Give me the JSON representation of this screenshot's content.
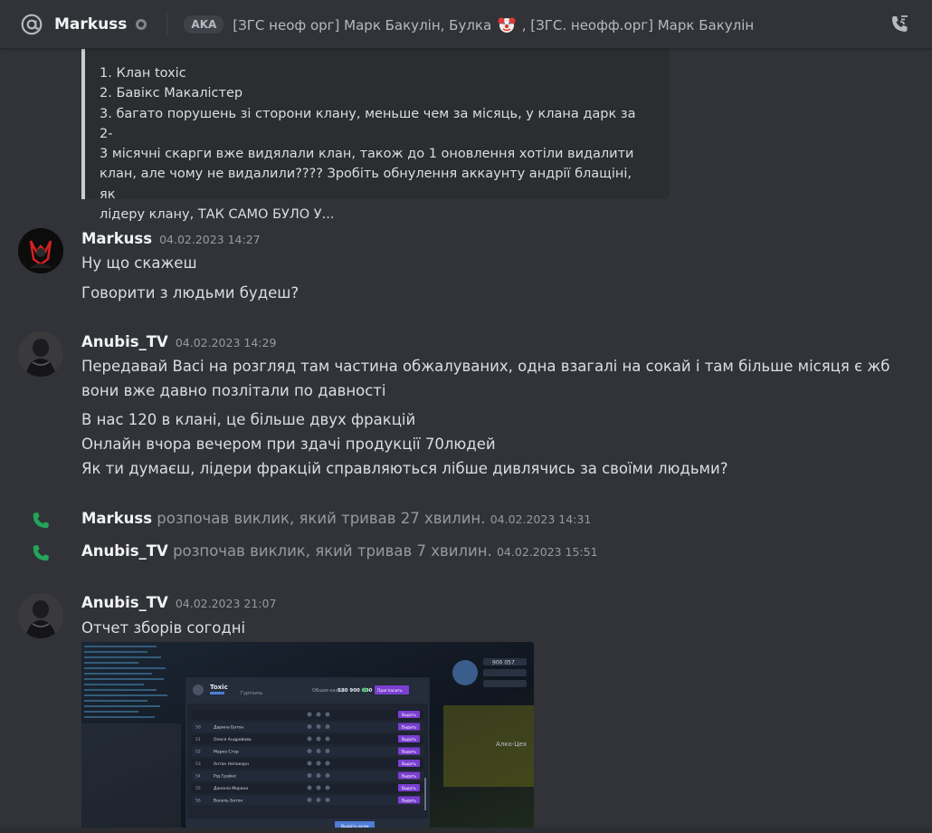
{
  "header": {
    "username": "Markuss",
    "aka_label": "AKA",
    "aka_names_part1": "[ЗГС неоф орг] Марк Бакулін, Булка",
    "aka_names_part2": ", [ЗГС. неофф.орг] Марк Бакулін",
    "icons": {
      "channel": "at-icon",
      "status": "offline-status-icon",
      "call": "start-call-icon",
      "emoji": "clown-emoji-icon"
    }
  },
  "quote": {
    "lines": [
      "1. Клан toxic",
      "2. Бавікс Макалістер",
      "3. багато порушень зі сторони клану, меньше чем за місяць, у клана дарк за 2-",
      "3 місячні скарги вже видялали клан, також до 1 оновлення хотіли видалити",
      "клан, але чому не видалили???? Зробіть обнулення аккаунту андрії блащіні, як",
      "лідеру клану, ТАК САМО БУЛО У..."
    ]
  },
  "messages": [
    {
      "author": "Markuss",
      "time": "04.02.2023 14:27",
      "lines": [
        "Ну що скажеш",
        "Говорити з людьми будеш?"
      ]
    },
    {
      "author": "Anubis_TV",
      "time": "04.02.2023 14:29",
      "lines": [
        "Передавай Васі на розгляд там частина обжалуваних, одна взагалі на сокай і там більше місяця є жб",
        "вони вже давно позлітали по давності",
        "В нас 120 в клані, це більше двух фракцій",
        "Онлайн вчора вечером при здачі продукції 70людей",
        "Як ти думаєш, лідери фракцій справляються лібше дивлячись за своїми людьми?"
      ]
    },
    {
      "author": "Anubis_TV",
      "time": "04.02.2023 21:07",
      "lines": [
        "Отчет зборів согодні"
      ]
    }
  ],
  "calls": [
    {
      "who": "Markuss",
      "text": " розпочав виклик, який тривав 27 хвилин.",
      "time": "04.02.2023 14:31"
    },
    {
      "who": "Anubis_TV",
      "text": " розпочав виклик, який тривав 7 хвилин.",
      "time": "04.02.2023 15:51"
    }
  ],
  "attachment": {
    "type": "game-screenshot",
    "clan_name": "Toxic",
    "clan_sub": "Гуртovnь",
    "balance_label": "Общая казна:",
    "balance_value": "530 900 000",
    "action_button": "Пригласить",
    "stats_value": "900 057",
    "zone_label": "Алко-Цех",
    "rows": [
      {
        "num": "",
        "name": "",
        "btn": "Выдать"
      },
      {
        "num": "50",
        "name": "Дарина Батон",
        "btn": "Выдать"
      },
      {
        "num": "51",
        "name": "Олеся Андрейовa",
        "btn": "Выдать"
      },
      {
        "num": "52",
        "name": "Марко Стор",
        "btn": "Выдать"
      },
      {
        "num": "53",
        "name": "Антон Непокорн",
        "btn": "Выдать"
      },
      {
        "num": "54",
        "name": "Рід Грайнс",
        "btn": "Выдать"
      },
      {
        "num": "55",
        "name": "Даніела Морано",
        "btn": "Выдать"
      },
      {
        "num": "56",
        "name": "Василь Батон",
        "btn": "Выдать"
      }
    ],
    "footer_button": "Выдать всем",
    "colors": {
      "bg": "#141a24",
      "panel": "#2a3140",
      "button": "#7b3fd1"
    }
  },
  "colors": {
    "background": "#313338",
    "embed_bg": "#2b2d31",
    "call_green": "#23a55a",
    "muted": "#949ba4"
  }
}
